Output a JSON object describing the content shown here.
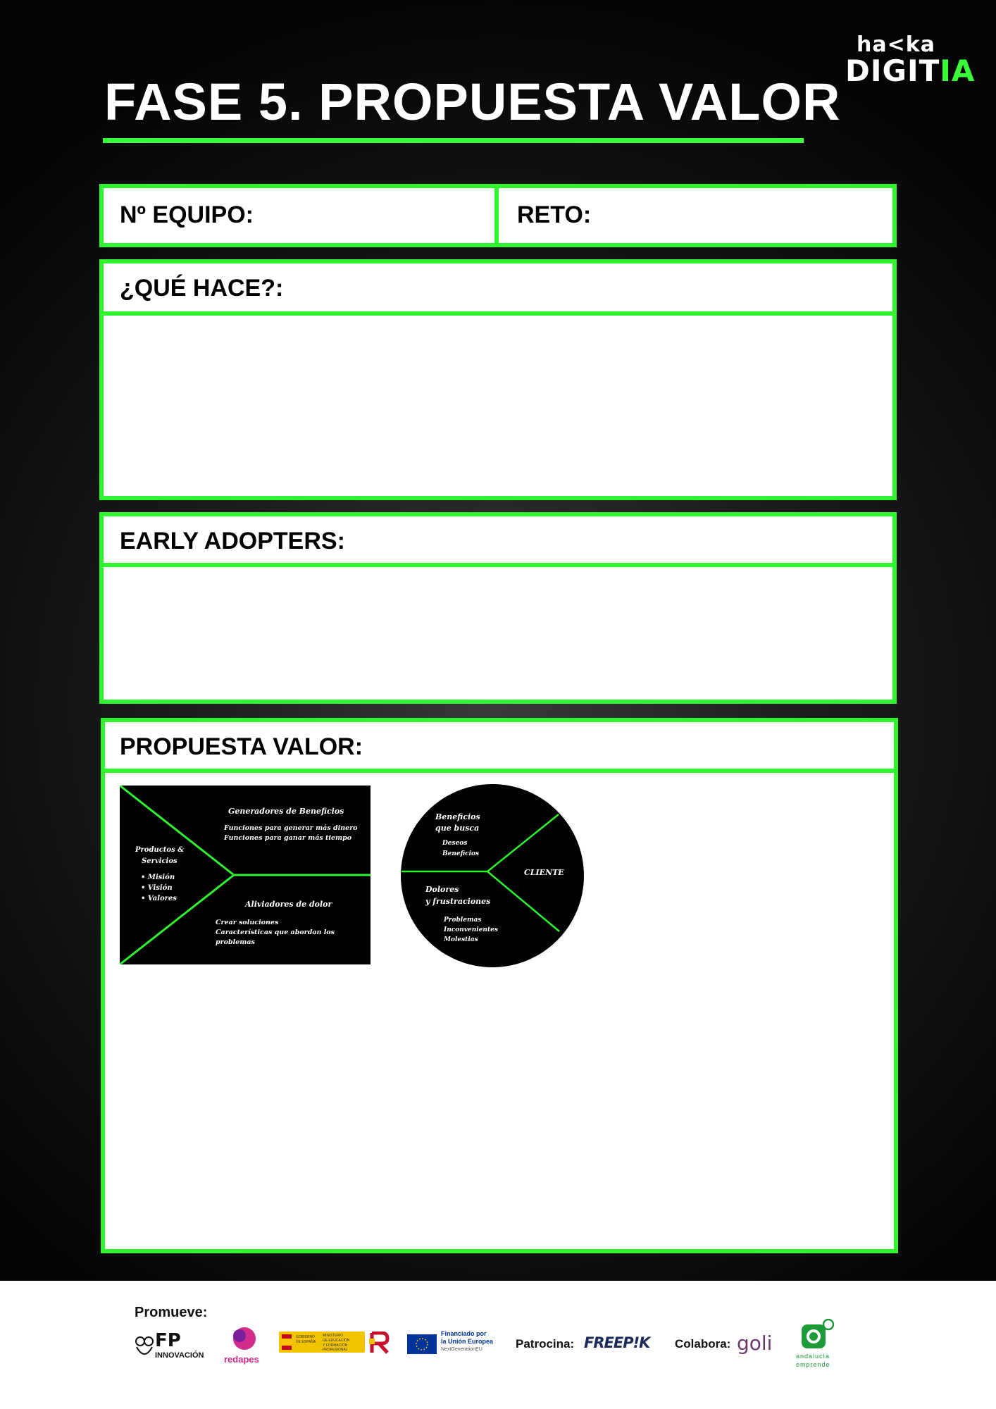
{
  "logo": {
    "line1": "ha<ka",
    "line2a": "DIGIT",
    "line2b": "IA"
  },
  "page_title": "FASE 5. PROPUESTA VALOR",
  "form": {
    "team_label": "Nº EQUIPO:",
    "challenge_label": "RETO:",
    "what_label": "¿QUÉ HACE?:",
    "early_label": "EARLY ADOPTERS:",
    "value_label": "PROPUESTA VALOR:"
  },
  "canvas_product": {
    "generators_title": "Generadores de Beneficios",
    "generators_1": "Funciones para generar más dinero",
    "generators_2": "Funciones para ganar más tiempo",
    "products_1": "Productos &",
    "products_2": "Servicios",
    "products_items": [
      "Misión",
      "Visión",
      "Valores"
    ],
    "relievers_title": "Aliviadores de dolor",
    "relievers_1": "Crear soluciones",
    "relievers_2": "Características que abordan los",
    "relievers_3": "problemas"
  },
  "canvas_customer": {
    "gains_1": "Beneficios",
    "gains_2": "que busca",
    "gains_items": [
      "Deseos",
      "Beneficios"
    ],
    "client": "CLIENTE",
    "pains_1": "Dolores",
    "pains_2": "y frustraciones",
    "pains_items": [
      "Problemas",
      "Inconvenientes",
      "Molestias"
    ]
  },
  "footer": {
    "promotes": "Promueve:",
    "sponsors": "Patrocina:",
    "collaborates": "Colabora:",
    "fp_logo": "FP",
    "fp_sub": "INNOVACIÓN",
    "redapes": "redapes",
    "gov_text_1": "GOBIERNO",
    "gov_text_2": "DE ESPAÑA",
    "ministry_1": "MINISTERIO",
    "ministry_2": "DE EDUCACIÓN",
    "ministry_3": "Y FORMACIÓN PROFESIONAL",
    "eu_1": "Financiado por",
    "eu_2": "la Unión Europea",
    "eu_3": "NextGenerationEU",
    "freepik": "FREEP!K",
    "goli": "goli",
    "andalucia_1": "andalucía",
    "andalucia_2": "emprende"
  },
  "colors": {
    "accent": "#2ff52f",
    "background": "#000000"
  }
}
